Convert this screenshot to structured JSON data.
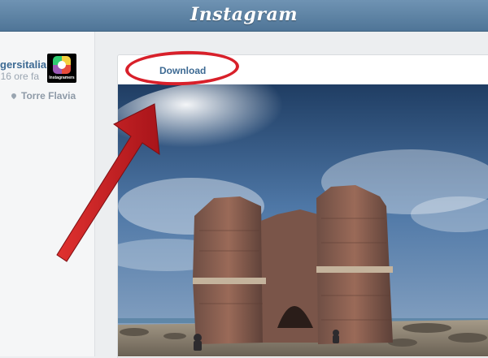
{
  "header": {
    "title": "Instagram"
  },
  "post": {
    "username": "gersitalia",
    "time": "16 ore fa",
    "location": "Torre Flavia",
    "avatar_label": "Instagramers"
  },
  "card": {
    "download_label": "Download"
  },
  "icons": {
    "location": "location-pin-icon",
    "avatar": "instagramers-logo-icon"
  },
  "colors": {
    "header": "#5b7fa2",
    "link": "#3d6a93",
    "annotation": "#d8202a"
  }
}
